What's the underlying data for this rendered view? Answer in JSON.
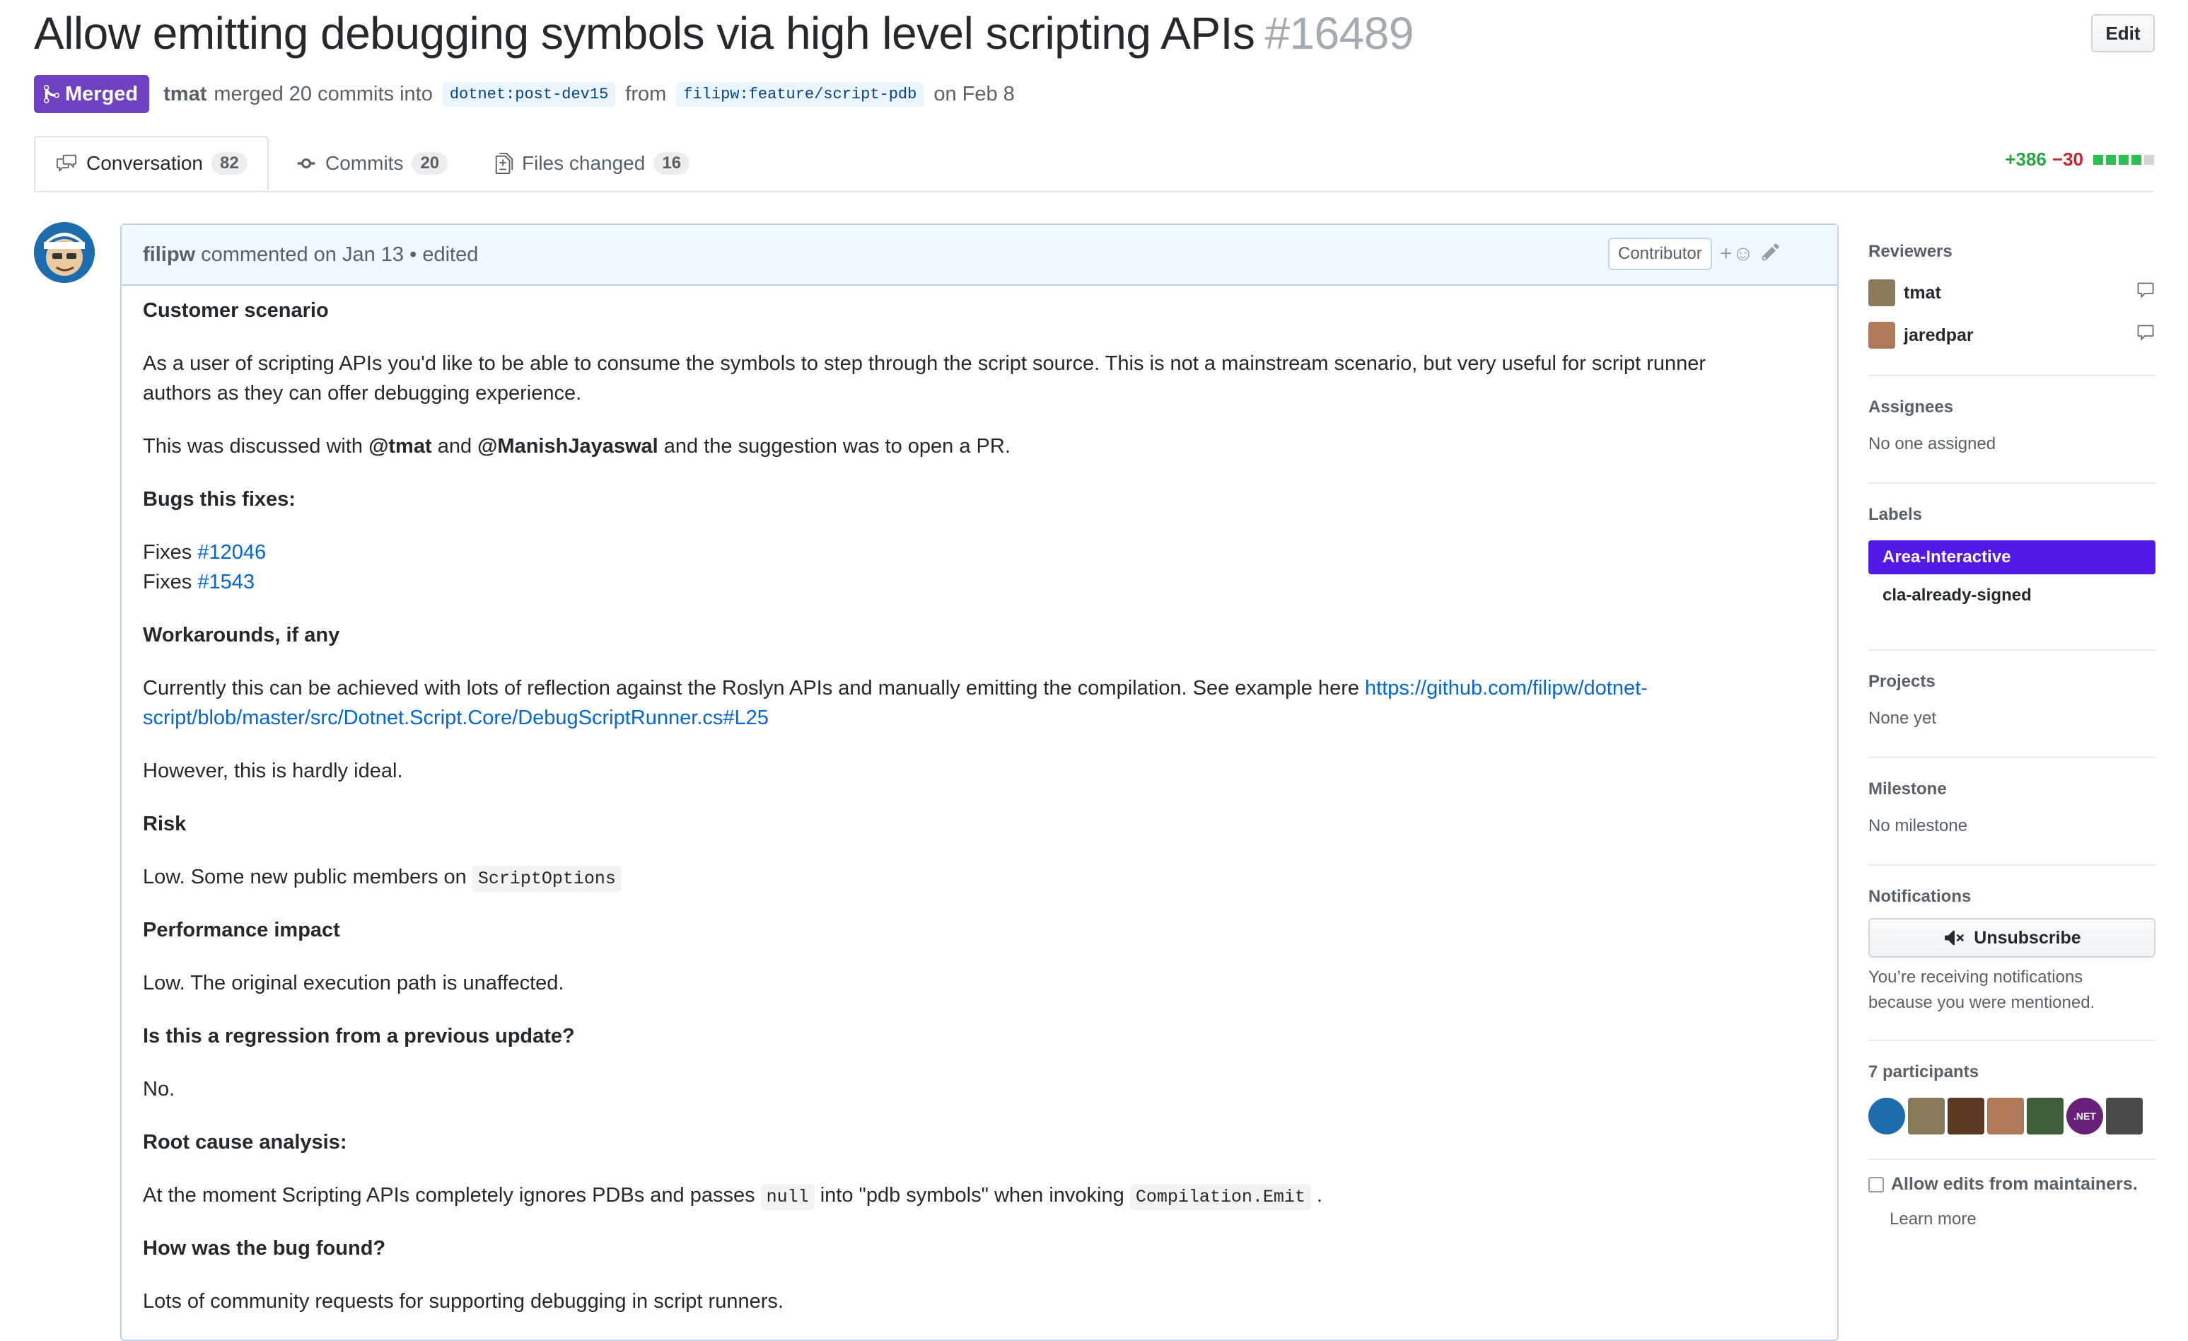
{
  "header": {
    "title": "Allow emitting debugging symbols via high level scripting APIs",
    "number": "#16489",
    "edit_label": "Edit"
  },
  "meta": {
    "status": "Merged",
    "user": "tmat",
    "text_merged": "merged 20 commits into",
    "base_branch": "dotnet:post-dev15",
    "text_from": "from",
    "head_branch": "filipw:feature/script-pdb",
    "date": "on Feb 8"
  },
  "tabs": [
    {
      "label": "Conversation",
      "count": "82"
    },
    {
      "label": "Commits",
      "count": "20"
    },
    {
      "label": "Files changed",
      "count": "16"
    }
  ],
  "diffstat": {
    "additions": "+386",
    "deletions": "−30"
  },
  "comment": {
    "author": "filipw",
    "header_text": "commented on Jan 13 • edited",
    "role": "Contributor",
    "reaction_glyph": "+☺",
    "h_scenario": "Customer scenario",
    "p_scenario_1": "As a user of scripting APIs you'd like to be able to consume the symbols to step through the script source. This is not a mainstream scenario, but very useful for script runner",
    "p_scenario_2": "authors as they can offer debugging experience.",
    "p_discussed_a": "This was discussed with ",
    "mention_1": "@tmat",
    "p_discussed_b": " and ",
    "mention_2": "@ManishJayaswal",
    "p_discussed_c": " and the suggestion was to open a PR.",
    "h_bugs": "Bugs this fixes:",
    "fixes_word": "Fixes ",
    "fix_1": "#12046",
    "fix_2": "#1543",
    "h_workarounds": "Workarounds, if any",
    "p_work_1": "Currently this can be achieved with lots of reflection against the Roslyn APIs and manually emitting the compilation. See example here ",
    "link_1": "https://github.com/filipw/dotnet-",
    "link_2": "script/blob/master/src/Dotnet.Script.Core/DebugScriptRunner.cs#L25",
    "p_however": "However, this is hardly ideal.",
    "h_risk": "Risk",
    "p_risk": "Low. Some new public members on ",
    "code_risk": "ScriptOptions",
    "h_perf": "Performance impact",
    "p_perf": "Low. The original execution path is unaffected.",
    "h_regression": "Is this a regression from a previous update?",
    "p_regression": "No.",
    "h_root": "Root cause analysis:",
    "p_root_a": "At the moment Scripting APIs completely ignores PDBs and passes ",
    "code_null": "null",
    "p_root_b": " into \"pdb symbols\" when invoking ",
    "code_emit": "Compilation.Emit",
    "p_root_c": " .",
    "h_found": "How was the bug found?",
    "p_found": "Lots of community requests for supporting debugging in script runners."
  },
  "sidebar": {
    "reviewers_heading": "Reviewers",
    "reviewers": [
      "tmat",
      "jaredpar"
    ],
    "assignees_heading": "Assignees",
    "assignees_text": "No one assigned",
    "labels_heading": "Labels",
    "labels": [
      {
        "name": "Area-Interactive",
        "color": "#5319e7",
        "text_color": "#ffffff"
      },
      {
        "name": "cla-already-signed",
        "color": "#ffffff",
        "text_color": "#24292e"
      }
    ],
    "projects_heading": "Projects",
    "projects_text": "None yet",
    "milestone_heading": "Milestone",
    "milestone_text": "No milestone",
    "notifications_heading": "Notifications",
    "unsubscribe_label": "Unsubscribe",
    "notif_reason_1": "You’re receiving notifications",
    "notif_reason_2": "because you were mentioned.",
    "participants_heading": "7 participants",
    "participant_colors": [
      "#1d6cae",
      "#8a7a5c",
      "#5a3a22",
      "#b07a5a",
      "#3f5f3a",
      "#68217a",
      "#4a4a4a"
    ],
    "net_badge": ".NET",
    "allow_edits": "Allow edits from maintainers.",
    "learn_more": "Learn more"
  },
  "colors": {
    "merged": "#6f42c1",
    "link": "#0366d6",
    "add": "#28a745",
    "del": "#cb2431"
  }
}
